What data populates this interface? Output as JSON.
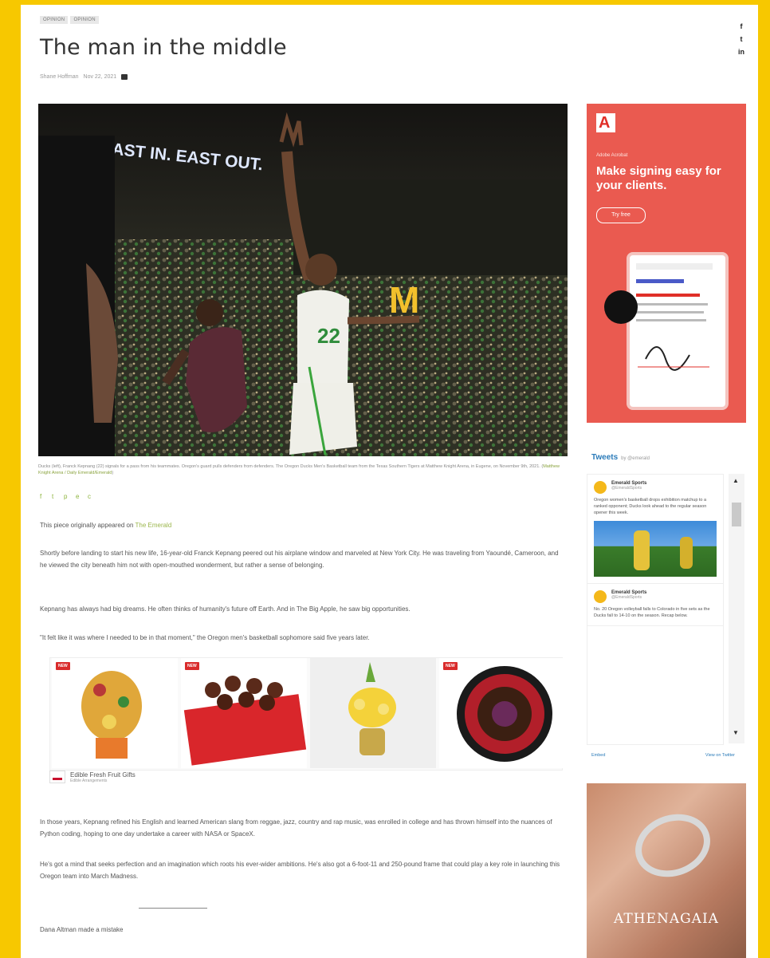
{
  "tags": [
    "Opinion",
    "Opinion"
  ],
  "title": "The man in the middle",
  "meta": {
    "author": "Shane Hoffman",
    "date": "Nov 22, 2021"
  },
  "share_rail": [
    "f",
    "t",
    "in"
  ],
  "hero": {
    "alt": "Basketball player in white Oregon uniform reaching up during a game",
    "banner_text": "EAST IN. EAST OUT.",
    "jersey_number": "22"
  },
  "caption": {
    "text": "Ducks (left), Franck Kepnang (22) signals for a pass from his teammates. Oregon's guard pulls defenders from defenders. The Oregon Ducks Men's Basketball team from the Texas Southern Tigers at Matthew Knight Arena, in Eugene, on November 9th, 2021. (",
    "credit": "Matthew Knight Arena / Daily Emerald/Emerald"
  },
  "article_socials": [
    "f",
    "t",
    "p",
    "e",
    "c"
  ],
  "article": {
    "intro": "This piece originally appeared on ",
    "intro_link": "The Emerald",
    "p1": "Shortly before landing to start his new life, 16-year-old Franck Kepnang peered out his airplane window and marveled at New York City. He was traveling from Yaoundé, Cameroon, and he viewed the city beneath him not with open-mouthed wonderment, but rather a sense of belonging.",
    "p2": "Kepnang has always had big dreams. He often thinks of humanity's future off Earth. And in The Big Apple, he saw big opportunities.",
    "p3": "\"It felt like it was where I needed to be in that moment,\" the Oregon men's basketball sophomore said five years later.",
    "p4": "In those years, Kepnang refined his English and learned American slang from reggae, jazz, country and rap music, was enrolled in college and has thrown himself into the nuances of Python coding, hoping to one day undertake a career with NASA or SpaceX.",
    "p5": "He's got a mind that seeks perfection and an imagination which roots his ever-wider ambitions. He's also got a 6-foot-11 and 250-pound frame that could play a key role in launching this Oregon team into March Madness.",
    "p6": "Dana Altman made a mistake"
  },
  "inline_ad": {
    "badge": "NEW",
    "brand": "Edible Fresh Fruit Gifts",
    "sub": "Edible Arrangements"
  },
  "sidebar_ad1": {
    "small": "Adobe Acrobat",
    "headline": "Make signing easy for your clients.",
    "button": "Try free"
  },
  "tweets": {
    "title": "Tweets",
    "by": "by @emerald",
    "items": [
      {
        "name": "Emerald Sports",
        "handle": "@EmeraldSports",
        "text": "Oregon women's basketball drops exhibition matchup to a ranked opponent; Ducks look ahead to the regular season opener this week."
      },
      {
        "name": "Emerald Sports",
        "handle": "@EmeraldSports",
        "text": "No. 20 Oregon volleyball falls to Colorado in five sets as the Ducks fall to 14-10 on the season. Recap below."
      }
    ],
    "embed": "Embed",
    "view": "View on Twitter"
  },
  "sidebar_ad2": {
    "brand": "ATHENAGAIA"
  }
}
